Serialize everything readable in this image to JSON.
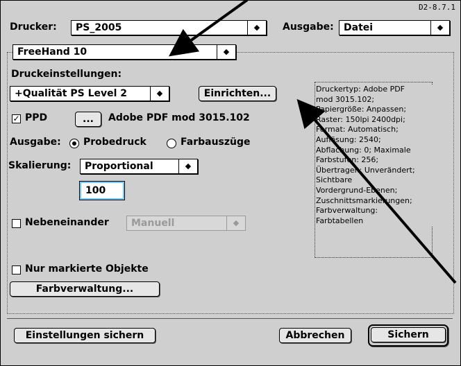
{
  "version": "D2-8.7.1",
  "printer": {
    "label": "Drucker:",
    "value": "PS_2005"
  },
  "output": {
    "label": "Ausgabe:",
    "value": "Datei"
  },
  "app_popup": {
    "value": "FreeHand 10"
  },
  "settings": {
    "label": "Druckeinstellungen:",
    "quality_value": "+Qualität PS Level 2",
    "setup_button": "Einrichten...",
    "ppd_label": "PPD",
    "ppd_button": "...",
    "ppd_file": "Adobe PDF mod 3015.102",
    "output_label": "Ausgabe:",
    "radio_composite": "Probedruck",
    "radio_separations": "Farbauszüge",
    "scaling_label": "Skalierung:",
    "scaling_value": "Proportional",
    "scale_percent": "100",
    "tile_label": "Nebeneinander",
    "tile_value": "Manuell",
    "selected_only_label": "Nur markierte Objekte",
    "color_mgmt_button": "Farbverwaltung..."
  },
  "info_panel": {
    "text": "Druckertyp: Adobe PDF\nmod 3015.102;\nPapiergröße: Anpassen;\nRaster: 150lpi 2400dpi;\nFormat: Automatisch;\nAuflösung: 2540;\nAbflachung: 0; Maximale\nFarbstufen: 256;\nÜbertragen: Unverändert;\nSichtbare\nVordergrund-Ebenen;\nZuschnittsmarkierungen;\nFarbverwaltung:\nFarbtabellen"
  },
  "footer": {
    "save_settings": "Einstellungen sichern",
    "cancel": "Abbrechen",
    "save": "Sichern"
  },
  "state": {
    "ppd_checked": true,
    "composite_selected": true,
    "tile_checked": false,
    "selected_only_checked": false
  }
}
